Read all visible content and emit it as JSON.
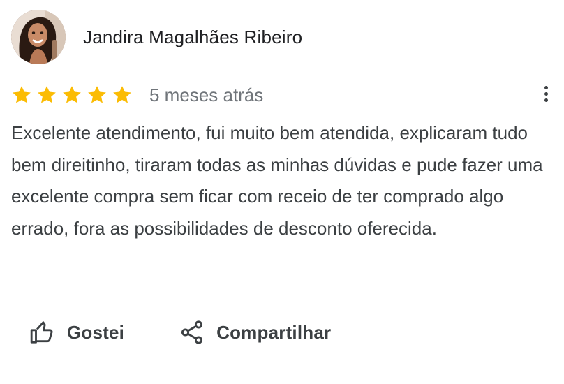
{
  "review": {
    "author_name": "Jandira Magalhães Ribeiro",
    "rating": 5,
    "rating_max": 5,
    "date": "5 meses atrás",
    "text": "Excelente atendimento, fui muito bem atendida, explicaram tudo bem direitinho, tiraram todas as minhas dúvidas e pude fazer uma excelente compra sem ficar com receio de ter comprado algo errado, fora as possibilidades de desconto oferecida.",
    "star_color": "#fbbc04"
  },
  "actions": {
    "like_label": "Gostei",
    "like_icon": "thumbs-up-icon",
    "share_label": "Compartilhar",
    "share_icon": "share-icon"
  },
  "menu": {
    "more_icon": "more-vert-icon"
  }
}
